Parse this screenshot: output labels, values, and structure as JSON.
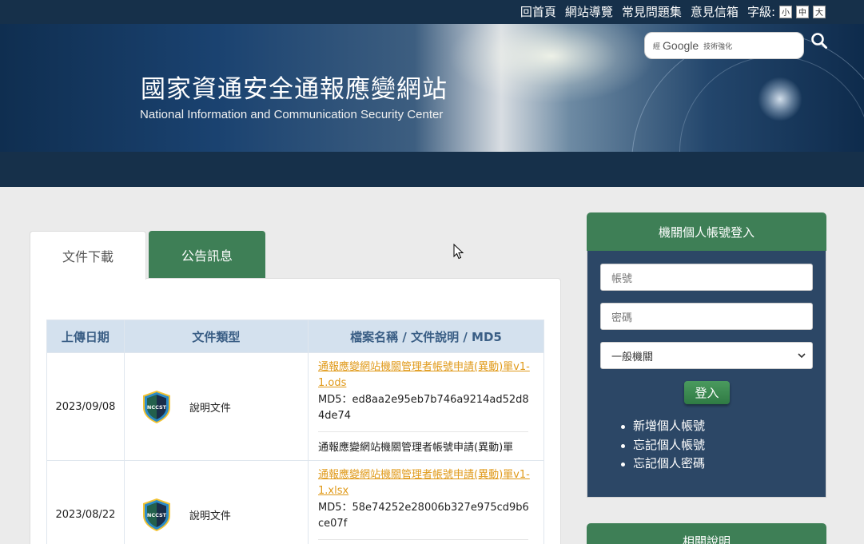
{
  "topnav": {
    "items": [
      "回首頁",
      "網站導覽",
      "常見問題集",
      "意見信箱"
    ],
    "font_label": "字級:",
    "font_sizes": [
      "小",
      "中",
      "大"
    ]
  },
  "header": {
    "title": "國家資通安全通報應變網站",
    "subtitle": "National Information and Communication Security Center"
  },
  "search": {
    "prefix": "經",
    "brand": "Google",
    "suffix": "技術強化"
  },
  "tabs": [
    {
      "label": "文件下載",
      "active": true
    },
    {
      "label": "公告訊息",
      "active": false
    }
  ],
  "table": {
    "headers": [
      "上傳日期",
      "文件類型",
      "檔案名稱 / 文件說明 / MD5"
    ],
    "rows": [
      {
        "date": "2023/09/08",
        "badge": "NCCST",
        "type": "說明文件",
        "file": "通報應變網站機關管理者帳號申請(異動)單v1-1.ods",
        "md5": "MD5：ed8aa2e95eb7b746a9214ad52d84de74",
        "desc": "通報應變網站機關管理者帳號申請(異動)單"
      },
      {
        "date": "2023/08/22",
        "badge": "NCCST",
        "type": "說明文件",
        "file": "通報應變網站機關管理者帳號申請(異動)單v1-1.xlsx",
        "md5": "MD5：58e74252e28006b327e975cd9b6ce07f",
        "desc": ""
      }
    ]
  },
  "login": {
    "title": "機關個人帳號登入",
    "account_placeholder": "帳號",
    "password_placeholder": "密碼",
    "org_type": "一般機關",
    "submit": "登入",
    "links": [
      "新增個人帳號",
      "忘記個人帳號",
      "忘記個人密碼"
    ]
  },
  "help": {
    "title": "相關說明"
  },
  "colors": {
    "navy": "#16304a",
    "green": "#3e7f56",
    "login_panel": "#2c4766",
    "link_orange": "#e09a1a"
  }
}
